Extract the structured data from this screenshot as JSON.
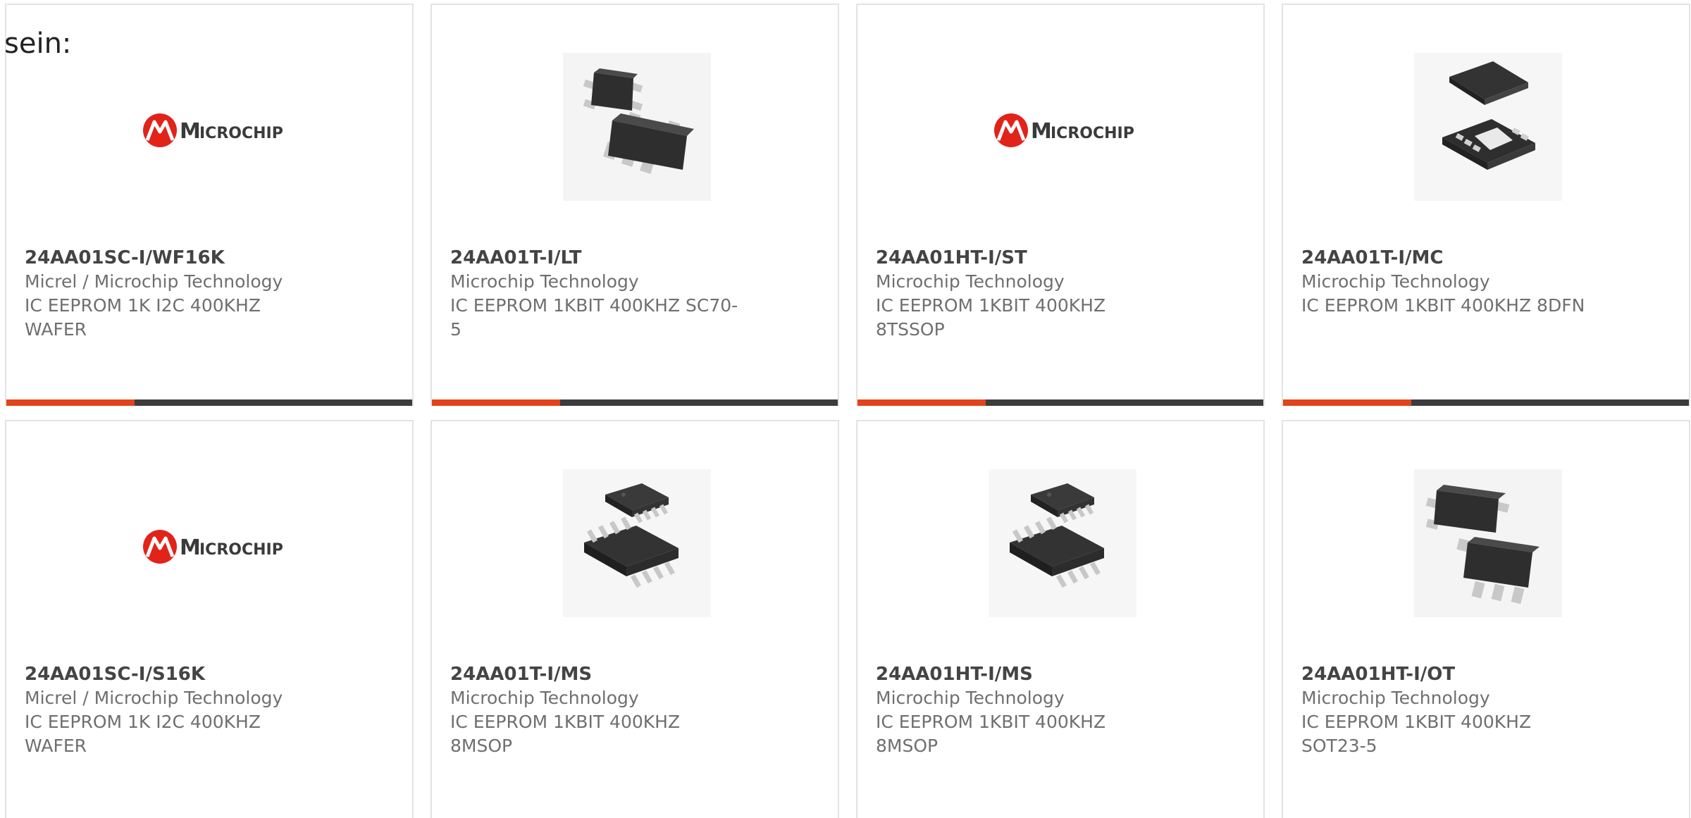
{
  "intro_text": "sein:",
  "colors": {
    "accent": "#e2431c",
    "bar_dark": "#3c3c3c",
    "border": "#e3e3e3",
    "logo_red": "#e2231a",
    "chip_body": "#2e2e2e"
  },
  "products": [
    {
      "part_number": "24AA01SC-I/WF16K",
      "manufacturer": "Micrel / Microchip Technology",
      "description": "IC EEPROM 1K I2C 400KHZ WAFER",
      "image": "microchip-logo"
    },
    {
      "part_number": "24AA01T-I/LT",
      "manufacturer": "Microchip Technology",
      "description": "IC EEPROM 1KBIT 400KHZ SC70-5",
      "image": "sc70-5-package"
    },
    {
      "part_number": "24AA01HT-I/ST",
      "manufacturer": "Microchip Technology",
      "description": "IC EEPROM 1KBIT 400KHZ 8TSSOP",
      "image": "microchip-logo"
    },
    {
      "part_number": "24AA01T-I/MC",
      "manufacturer": "Microchip Technology",
      "description": "IC EEPROM 1KBIT 400KHZ 8DFN",
      "image": "dfn-8-package"
    },
    {
      "part_number": "24AA01SC-I/S16K",
      "manufacturer": "Micrel / Microchip Technology",
      "description": "IC EEPROM 1K I2C 400KHZ WAFER",
      "image": "microchip-logo"
    },
    {
      "part_number": "24AA01T-I/MS",
      "manufacturer": "Microchip Technology",
      "description": "IC EEPROM 1KBIT 400KHZ 8MSOP",
      "image": "msop-8-package"
    },
    {
      "part_number": "24AA01HT-I/MS",
      "manufacturer": "Microchip Technology",
      "description": "IC EEPROM 1KBIT 400KHZ 8MSOP",
      "image": "msop-8-package"
    },
    {
      "part_number": "24AA01HT-I/OT",
      "manufacturer": "Microchip Technology",
      "description": "IC EEPROM 1KBIT 400KHZ SOT23-5",
      "image": "sot23-5-package"
    }
  ]
}
